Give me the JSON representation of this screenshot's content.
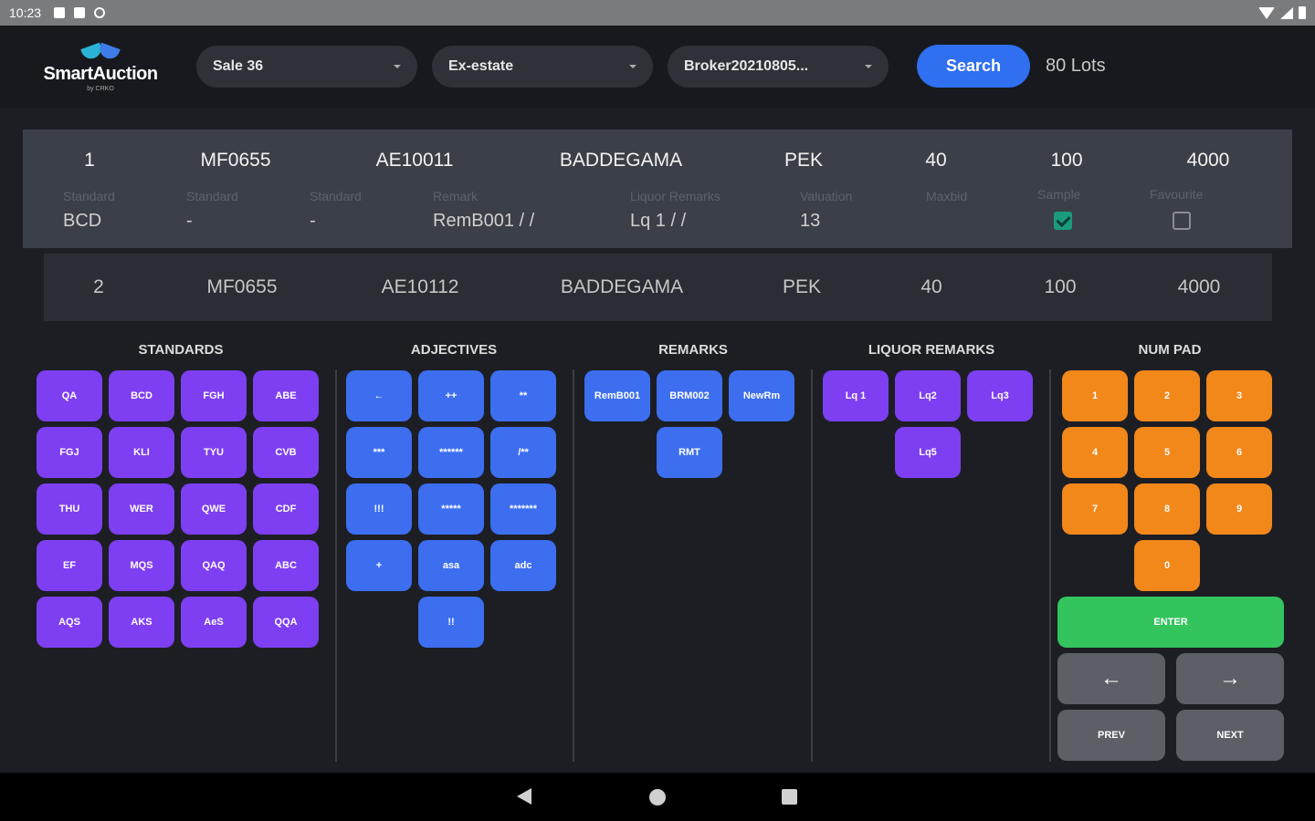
{
  "status_bar": {
    "time": "10:23"
  },
  "header": {
    "logo_text": "SmartAuction",
    "logo_sub": "by CRKO",
    "sale_select": "Sale 36",
    "estate_select": "Ex-estate",
    "broker_select": "Broker20210805...",
    "search_label": "Search",
    "lots_count": "80 Lots"
  },
  "lots": [
    {
      "cells": [
        "1",
        "MF0655",
        "AE10011",
        "BADDEGAMA",
        "PEK",
        "40",
        "100",
        "4000"
      ],
      "labels": [
        "Standard",
        "Standard",
        "Standard",
        "Remark",
        "Liquor Remarks",
        "Valuation",
        "Maxbid",
        "Sample",
        "Favourite"
      ],
      "values": [
        "BCD",
        "-",
        "-",
        "RemB001 /   /",
        "Lq 1 /   /",
        "13"
      ],
      "sample_checked": true,
      "favourite_checked": false
    },
    {
      "cells": [
        "2",
        "MF0655",
        "AE10112",
        "BADDEGAMA",
        "PEK",
        "40",
        "100",
        "4000"
      ]
    }
  ],
  "sections": {
    "standards": "STANDARDS",
    "adjectives": "ADJECTIVES",
    "remarks": "REMARKS",
    "liquor_remarks": "LIQUOR REMARKS",
    "num_pad": "NUM PAD"
  },
  "standards_keys": [
    "QA",
    "BCD",
    "FGH",
    "ABE",
    "FGJ",
    "KLI",
    "TYU",
    "CVB",
    "THU",
    "WER",
    "QWE",
    "CDF",
    "EF",
    "MQS",
    "QAQ",
    "ABC",
    "AQS",
    "AKS",
    "AeS",
    "QQA"
  ],
  "adjective_keys": [
    "←",
    "++",
    "**",
    "***",
    "******",
    "/**",
    "!!!",
    "*****",
    "*******",
    "+",
    "asa",
    "adc",
    "!!"
  ],
  "remark_keys": [
    "RemB001",
    "BRM002",
    "NewRm",
    "RMT"
  ],
  "liquor_keys": [
    "Lq 1",
    "Lq2",
    "Lq3",
    "Lq5"
  ],
  "numpad_keys": [
    "1",
    "2",
    "3",
    "4",
    "5",
    "6",
    "7",
    "8",
    "9",
    "0"
  ],
  "numpad_actions": {
    "enter": "ENTER",
    "left": "←",
    "right": "→",
    "prev": "PREV",
    "next": "NEXT"
  },
  "colors": {
    "purple": "#7e3ff2",
    "blue": "#3d6ef0",
    "orange": "#f2871a",
    "green": "#33c45e",
    "accent": "#2f6ff0"
  }
}
